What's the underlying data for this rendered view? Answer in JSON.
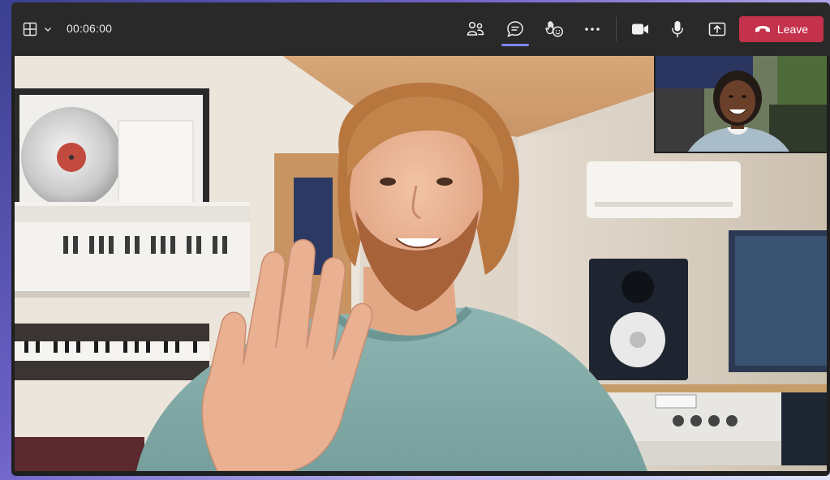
{
  "app": {
    "accent": "#7f85f5",
    "leave_color": "#c4314b",
    "toolbar_color": "#292929"
  },
  "toolbar": {
    "timer": "00:06:00",
    "layout_icon": "grid-layout-icon",
    "people_icon": "people-icon",
    "chat_icon": "chat-icon",
    "react_icon": "raise-hand-react-icon",
    "more_icon": "more-options-icon",
    "camera_icon": "video-camera-icon",
    "mic_icon": "microphone-icon",
    "share_icon": "share-screen-icon",
    "leave_label": "Leave",
    "leave_icon": "phone-hangup-icon"
  },
  "main_video": {
    "description_icon": "participant-video"
  },
  "self_view": {
    "description_icon": "self-view-video"
  }
}
